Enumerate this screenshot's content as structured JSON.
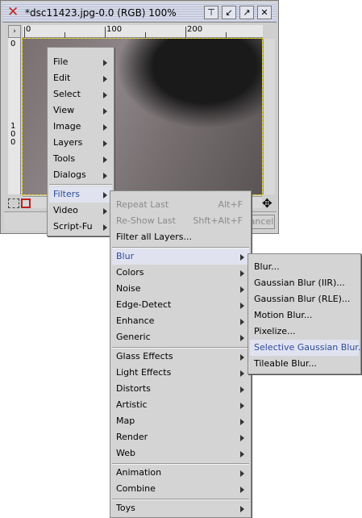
{
  "window": {
    "title": "*dsc11423.jpg-0.0 (RGB) 100%",
    "status_cancel": "Cancel",
    "ruler_top": [
      "0",
      "100",
      "200"
    ],
    "ruler_left": [
      "0",
      "1",
      "0",
      "0"
    ]
  },
  "main_menu": {
    "items": [
      {
        "label": "File"
      },
      {
        "label": "Edit"
      },
      {
        "label": "Select"
      },
      {
        "label": "View"
      },
      {
        "label": "Image"
      },
      {
        "label": "Layers"
      },
      {
        "label": "Tools"
      },
      {
        "label": "Dialogs"
      },
      {
        "label": "Filters"
      },
      {
        "label": "Video"
      },
      {
        "label": "Script-Fu"
      }
    ]
  },
  "filters_menu": {
    "top": [
      {
        "label": "Repeat Last",
        "shortcut": "Alt+F"
      },
      {
        "label": "Re-Show Last",
        "shortcut": "Shft+Alt+F"
      },
      {
        "label": "Filter all Layers..."
      }
    ],
    "group1": [
      {
        "label": "Blur"
      },
      {
        "label": "Colors"
      },
      {
        "label": "Noise"
      },
      {
        "label": "Edge-Detect"
      },
      {
        "label": "Enhance"
      },
      {
        "label": "Generic"
      }
    ],
    "group2": [
      {
        "label": "Glass Effects"
      },
      {
        "label": "Light Effects"
      },
      {
        "label": "Distorts"
      },
      {
        "label": "Artistic"
      },
      {
        "label": "Map"
      },
      {
        "label": "Render"
      },
      {
        "label": "Web"
      }
    ],
    "group3": [
      {
        "label": "Animation"
      },
      {
        "label": "Combine"
      }
    ],
    "group4": [
      {
        "label": "Toys"
      }
    ]
  },
  "blur_menu": {
    "items": [
      {
        "label": "Blur..."
      },
      {
        "label": "Gaussian Blur (IIR)..."
      },
      {
        "label": "Gaussian Blur (RLE)..."
      },
      {
        "label": "Motion Blur..."
      },
      {
        "label": "Pixelize..."
      },
      {
        "label": "Selective Gaussian Blur..."
      },
      {
        "label": "Tileable Blur..."
      }
    ]
  }
}
